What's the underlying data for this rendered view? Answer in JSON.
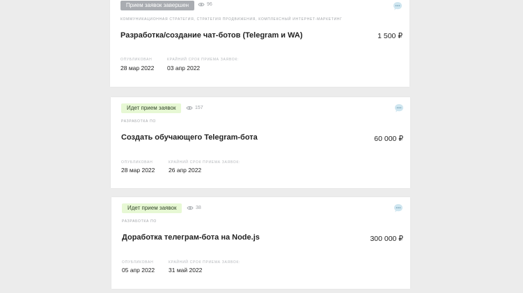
{
  "cards": [
    {
      "status": "Прием заявок завершен",
      "views": "96",
      "category": "Коммуникационная стратегия, стратегия продвижения, комплексный интернет-маркетинг",
      "title": "Разработка/создание чат-ботов (Telegram и WA)",
      "price": "1 500 ₽",
      "published_label": "Опубликован",
      "published_value": "28 мар 2022",
      "deadline_label": "Крайний срок приема заявок:",
      "deadline_value": "03 апр 2022"
    },
    {
      "status": "Идет прием заявок",
      "views": "157",
      "category": "Разработка ПО",
      "title": "Создать обучающего Telegram-бота",
      "price": "60 000 ₽",
      "published_label": "Опубликован",
      "published_value": "28 мар 2022",
      "deadline_label": "Крайний срок приема заявок:",
      "deadline_value": "26 апр 2022"
    },
    {
      "status": "Идет прием заявок",
      "views": "38",
      "category": "Разработка ПО",
      "title": "Доработка телеграм-бота на Node.js",
      "price": "300 000 ₽",
      "published_label": "Опубликован",
      "published_value": "05 апр 2022",
      "deadline_label": "Крайний срок приема заявок:",
      "deadline_value": "31 май 2022"
    }
  ],
  "icons": {
    "views": "eye-icon",
    "chat": "chat-bubble-icon"
  },
  "colors": {
    "background": "#ececec",
    "card": "#ffffff",
    "closed_badge": "#a9acb1",
    "open_badge": "#e7f8d4",
    "chat_icon": "#cfe6f0",
    "chat_icon_dots": "#7aa3b8"
  }
}
